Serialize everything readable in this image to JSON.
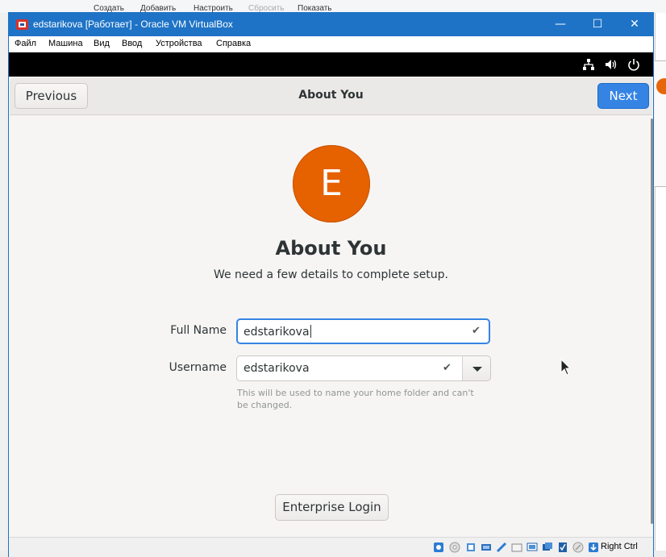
{
  "host": {
    "toolbar_items": [
      "Создать",
      "Добавить",
      "Настроить",
      "Сбросить",
      "Показать"
    ]
  },
  "window": {
    "title": "edstarikova [Работает] - Oracle VM VirtualBox",
    "minimize_glyph": "—",
    "maximize_glyph": "☐",
    "close_glyph": "✕"
  },
  "menu": {
    "items": [
      "Файл",
      "Машина",
      "Вид",
      "Ввод",
      "Устройства",
      "Справка"
    ]
  },
  "guest_topbar": {
    "icons": [
      "network-icon",
      "volume-icon",
      "power-icon"
    ]
  },
  "headerbar": {
    "previous_label": "Previous",
    "title": "About You",
    "next_label": "Next"
  },
  "page": {
    "avatar_letter": "E",
    "avatar_color": "#e66100",
    "heading": "About You",
    "subheading": "We need a few details to complete setup."
  },
  "form": {
    "full_name_label": "Full Name",
    "full_name_value": "edstarikova",
    "username_label": "Username",
    "username_value": "edstarikova",
    "username_hint": "This will be used to name your home folder and can't be changed."
  },
  "enterprise_login_label": "Enterprise Login",
  "statusbar": {
    "host_key_label": "Right Ctrl"
  },
  "colors": {
    "titlebar": "#1e73c6",
    "accent": "#3584e4",
    "avatar": "#e66100"
  }
}
